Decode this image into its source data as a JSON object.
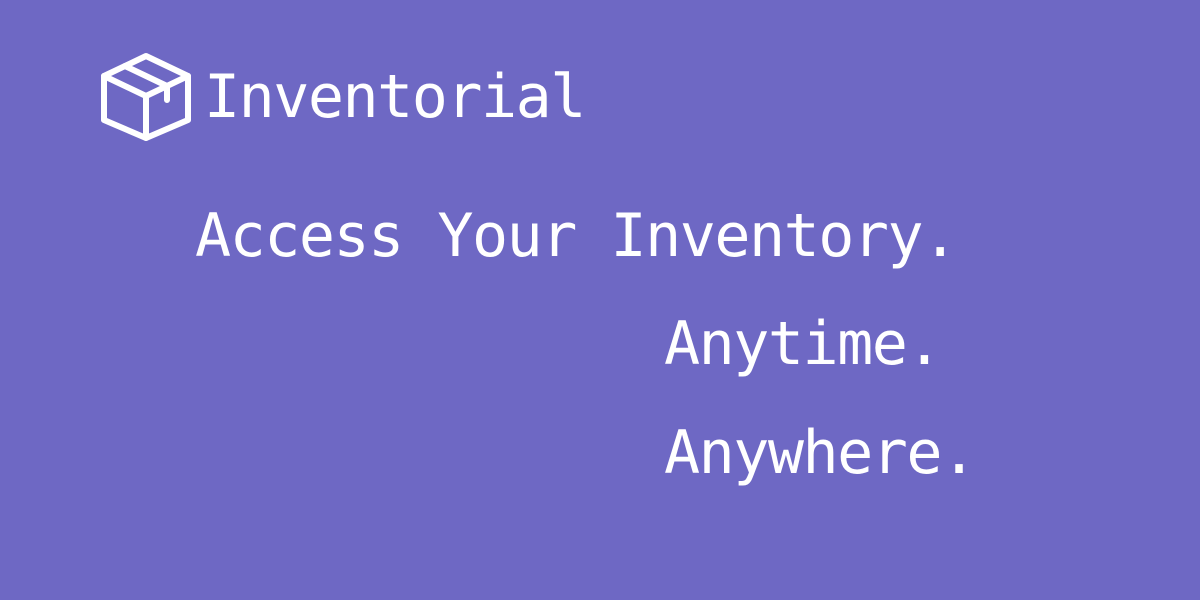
{
  "brand": {
    "logo_icon": "box-icon",
    "name": "Inventorial"
  },
  "tagline": {
    "line1": "Access Your Inventory.",
    "line2": "Anytime.",
    "line3": "Anywhere."
  },
  "colors": {
    "background": "#6e68c4",
    "text": "#ffffff"
  }
}
